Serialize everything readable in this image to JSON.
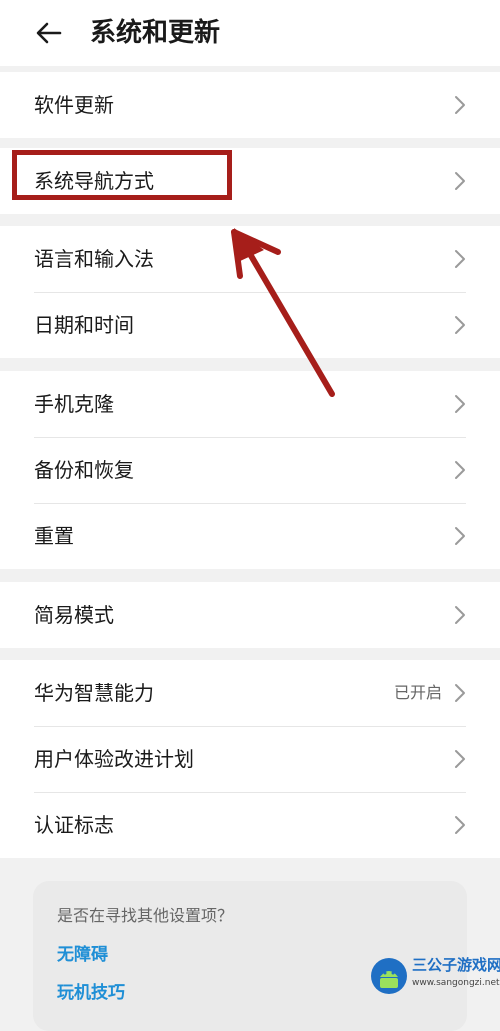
{
  "header": {
    "title": "系统和更新",
    "back_icon": "arrow-left-icon"
  },
  "groups": [
    {
      "items": [
        {
          "label": "软件更新"
        }
      ]
    },
    {
      "items": [
        {
          "label": "系统导航方式",
          "highlighted": true
        }
      ]
    },
    {
      "items": [
        {
          "label": "语言和输入法"
        },
        {
          "label": "日期和时间"
        }
      ]
    },
    {
      "items": [
        {
          "label": "手机克隆"
        },
        {
          "label": "备份和恢复"
        },
        {
          "label": "重置"
        }
      ]
    },
    {
      "items": [
        {
          "label": "简易模式"
        }
      ]
    },
    {
      "items": [
        {
          "label": "华为智慧能力",
          "value": "已开启"
        },
        {
          "label": "用户体验改进计划"
        },
        {
          "label": "认证标志"
        }
      ]
    }
  ],
  "suggestions": {
    "title": "是否在寻找其他设置项？",
    "links": [
      "无障碍",
      "玩机技巧"
    ]
  },
  "annotation": {
    "color": "#a61e1a"
  },
  "watermark": {
    "name": "三公子游戏网",
    "url": "www.sangongzi.net"
  },
  "colors": {
    "background": "#f1f1f1",
    "card": "#ffffff",
    "link": "#1f8fd6"
  }
}
